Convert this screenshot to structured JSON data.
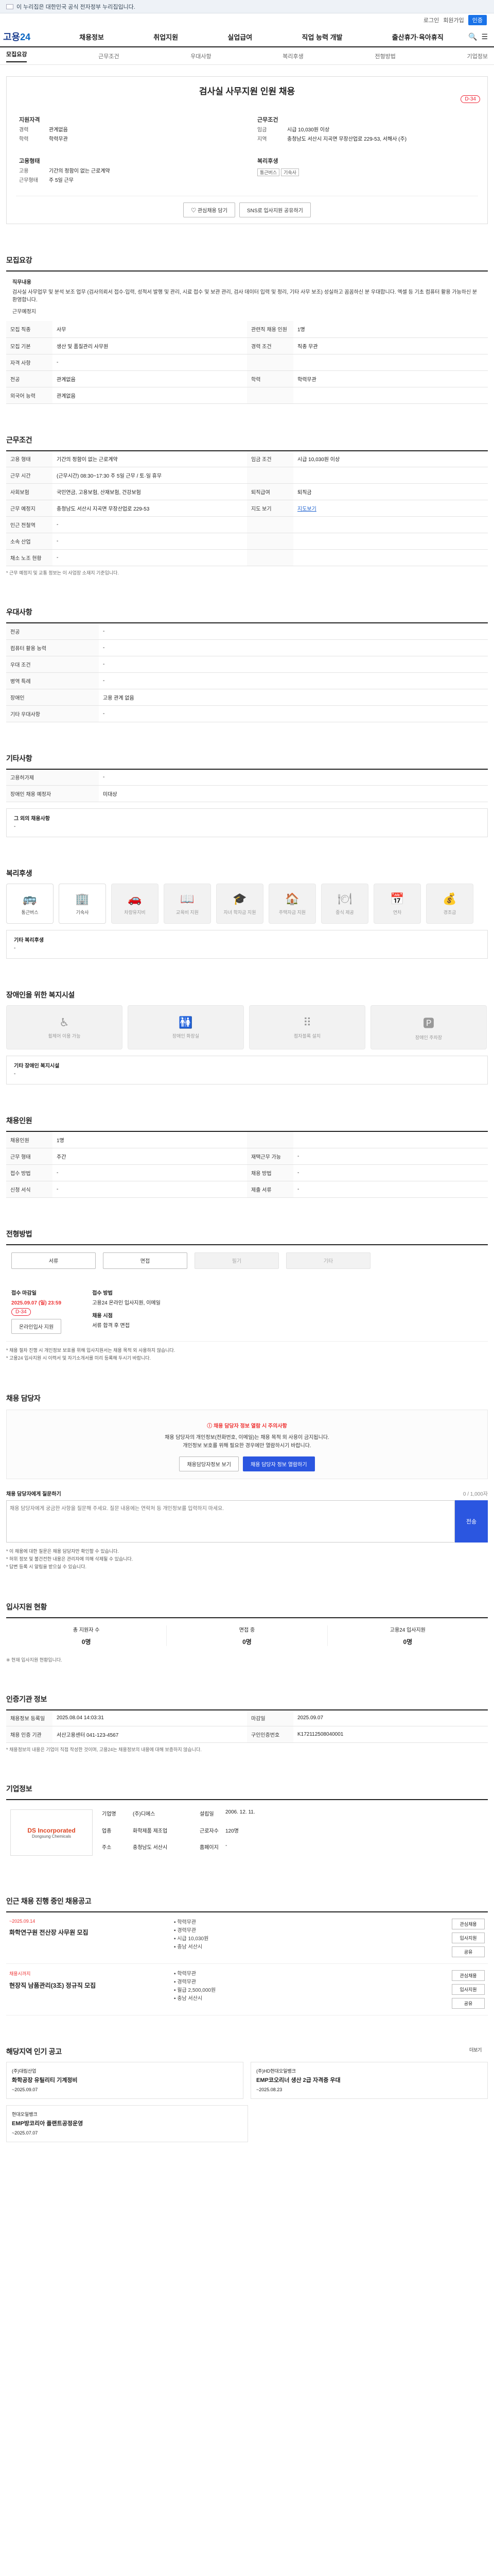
{
  "gov": {
    "text": "이 누리집은 대한민국 공식 전자정부 누리집입니다."
  },
  "util": {
    "login": "로그인",
    "join": "회원가입",
    "cert": "인증"
  },
  "logo": {
    "a": "고용",
    "b": "24"
  },
  "gnb": [
    "채용정보",
    "취업지원",
    "실업급여",
    "직업 능력 개발",
    "출산휴가·육아휴직"
  ],
  "tabs": [
    "모집요강",
    "근무조건",
    "우대사항",
    "복리후생",
    "전형방법",
    "기업정보"
  ],
  "posting": {
    "title": "검사실 사무지원 인원 채용",
    "dday": "D-34",
    "left_head": "지원자격",
    "right_head": "근무조건",
    "left": [
      {
        "k": "경력",
        "v": "관계없음"
      },
      {
        "k": "학력",
        "v": "학력무관"
      }
    ],
    "right": [
      {
        "k": "임금",
        "v": "시급 10,030원 이상"
      },
      {
        "k": "지역",
        "v": "충청남도 서산시 지곡면 무장산업로 229-53, 서해사 (주)"
      }
    ],
    "left2_head": "고용형태",
    "right2_head": "복리후생",
    "left2": [
      {
        "k": "고용",
        "v": "기간의 정함이 없는 근로계약"
      },
      {
        "k": "근무형태",
        "v": "주 5일 근무"
      }
    ],
    "benefits": [
      "통근버스",
      "기숙사"
    ],
    "btn_save": "관심채용 담기",
    "btn_share": "SNS로 입사지원 공유하기"
  },
  "s1": {
    "title": "모집요강",
    "lbl": "직무내용",
    "desc": "검사실 사무업무 및 분석 보조 업무 (검사의뢰서 접수·입력, 성적서 발행 및 관리, 시료 접수 및 보관 관리, 검사 데이터 입력 및 정리, 기타 사무 보조) 성실하고 꼼꼼하신 분 우대합니다. 엑셀 등 기초 컴퓨터 활용 가능하신 분 환영합니다.",
    "lbl2": "근무예정지",
    "rows": [
      [
        {
          "k": "모집 직종",
          "v": "사무"
        },
        {
          "k": "관련직 채용 인원",
          "v": "1명"
        }
      ],
      [
        {
          "k": "모집 기본",
          "v": "생산 및 품질관리 사무원"
        },
        {
          "k": "경력 조건",
          "v": "직종 무관"
        }
      ],
      [
        {
          "k": "자격 사항",
          "v": "-"
        },
        {
          "k": "",
          "v": ""
        }
      ],
      [
        {
          "k": "전공",
          "v": "관계없음"
        },
        {
          "k": "학력",
          "v": "학력무관"
        }
      ],
      [
        {
          "k": "외국어 능력",
          "v": "관계없음"
        },
        {
          "k": "",
          "v": ""
        }
      ]
    ]
  },
  "s2": {
    "title": "근무조건",
    "rows": [
      [
        {
          "k": "고용 형태",
          "v": "기간의 정함이 없는 근로계약"
        },
        {
          "k": "임금 조건",
          "v": "시급 10,030원 이상"
        }
      ],
      [
        {
          "k": "근무 시간",
          "v": "(근무시간) 08:30~17:30 주 5일 근무 / 토·일 휴무"
        },
        {
          "k": "",
          "v": ""
        }
      ],
      [
        {
          "k": "사회보험",
          "v": "국민연금, 고용보험, 산재보험, 건강보험"
        },
        {
          "k": "퇴직급여",
          "v": "퇴직금"
        }
      ],
      [
        {
          "k": "근무 예정지",
          "v": "충청남도 서산시 지곡면 무장산업로 229-53"
        },
        {
          "k": "지도 보기",
          "v": "지도보기"
        }
      ],
      [
        {
          "k": "인근 전철역",
          "v": "-"
        },
        {
          "k": "",
          "v": ""
        }
      ],
      [
        {
          "k": "소속 산업",
          "v": "-"
        },
        {
          "k": "",
          "v": ""
        }
      ],
      [
        {
          "k": "채소 노조 현황",
          "v": "-"
        },
        {
          "k": "",
          "v": ""
        }
      ]
    ],
    "note": "* 근무 예정지 및 교통 정보는 이 사업장 소재지 기준입니다."
  },
  "s3": {
    "title": "우대사항",
    "rows": [
      [
        {
          "k": "전공",
          "v": "-"
        }
      ],
      [
        {
          "k": "컴퓨터 활용 능력",
          "v": "-"
        }
      ],
      [
        {
          "k": "우대 조건",
          "v": "-"
        }
      ],
      [
        {
          "k": "병역 특례",
          "v": "-"
        }
      ],
      [
        {
          "k": "장애인",
          "v": "고용 관계 없음"
        }
      ],
      [
        {
          "k": "기타 우대사항",
          "v": "-"
        }
      ]
    ]
  },
  "s4": {
    "title": "기타사항",
    "rows": [
      [
        {
          "k": "고용허가제",
          "v": "-"
        }
      ],
      [
        {
          "k": "장애인 채용 예정자",
          "v": "미대상"
        }
      ]
    ],
    "box_t": "그 외의 채용사항",
    "box_v": "-"
  },
  "s5": {
    "title": "복리후생",
    "icons": [
      {
        "n": "통근버스",
        "on": true,
        "g": "🚌"
      },
      {
        "n": "기숙사",
        "on": true,
        "g": "🏢"
      },
      {
        "n": "차량유지비",
        "on": false,
        "g": "🚗"
      },
      {
        "n": "교육비 지원",
        "on": false,
        "g": "📖"
      },
      {
        "n": "자녀 학자금 지원",
        "on": false,
        "g": "🎓"
      },
      {
        "n": "주택자금 지원",
        "on": false,
        "g": "🏠"
      },
      {
        "n": "중식 제공",
        "on": false,
        "g": "🍽"
      },
      {
        "n": "연차",
        "on": false,
        "g": "📅"
      },
      {
        "n": "경조금",
        "on": false,
        "g": "💰"
      }
    ],
    "box_t": "기타 복리후생",
    "box_v": "-"
  },
  "s6": {
    "title": "장애인을 위한 복지시설",
    "icons": [
      {
        "n": "휠체어 이용 가능",
        "g": "♿"
      },
      {
        "n": "장애인 화장실",
        "g": "🚻"
      },
      {
        "n": "점자블록 설치",
        "g": "⠿"
      },
      {
        "n": "장애인 주차장",
        "g": "🅿"
      }
    ],
    "box_t": "기타 장애인 복지시설",
    "box_v": "-"
  },
  "s7": {
    "title": "채용인원",
    "rows": [
      [
        {
          "k": "채용인원",
          "v": "1명"
        },
        {
          "k": "",
          "v": ""
        }
      ],
      [
        {
          "k": "근무 형태",
          "v": "주간"
        },
        {
          "k": "재택근무 가능",
          "v": "-"
        }
      ],
      [
        {
          "k": "접수 방법",
          "v": "-"
        },
        {
          "k": "채용 방법",
          "v": "-"
        }
      ],
      [
        {
          "k": "신청 서식",
          "v": "-"
        },
        {
          "k": "제출 서류",
          "v": "-"
        }
      ]
    ]
  },
  "s8": {
    "title": "전형방법",
    "steps": [
      {
        "n": "서류",
        "on": true
      },
      {
        "n": "면접",
        "on": true
      },
      {
        "n": "필기",
        "on": false
      },
      {
        "n": "기타",
        "on": false
      }
    ],
    "p1": "접수 마감일",
    "p1v": "2025.09.07 (일) 23:59",
    "p1s": "D-34",
    "p2": "접수 방법",
    "p2v": "고용24 온라인 입사지원, 이메일",
    "p3": "채용 시점",
    "p3v": "서류 합격 후 면접",
    "btn": "온라인입사 지원",
    "notes": [
      "* 채용 절차 진행 시 개인정보 보호를 위해 입사지원서는 채용 목적 외 사용하지 않습니다.",
      "* 고용24 입사지원 시 이력서 및 자기소개서를 미리 등록해 두시기 바랍니다."
    ]
  },
  "s9": {
    "title": "채용 담당자",
    "warn1": "채용 담당자 정보 열람 시 주의사항",
    "warn2": "채용 담당자의 개인정보(전화번호, 이메일)는 채용 목적 외 사용이 금지됩니다.",
    "warn3": "개인정보 보호를 위해 필요한 경우에만 열람하시기 바랍니다.",
    "b1": "채용담당자정보 보기",
    "b2": "채용 담당자 정보 열람하기",
    "qa_t": "채용 담당자에게 질문하기",
    "qa_r": "0 / 1,000자",
    "qa_p": "채용 담당자에게 궁금한 사항을 질문해 주세요. 질문 내용에는 연락처 등 개인정보를 입력하지 마세요.",
    "qa_btn": "전송",
    "qn": [
      "* 이 채용에 대한 질문은 채용 담당자만 확인할 수 있습니다.",
      "* 허위 정보 및 불건전한 내용은 관리자에 의해 삭제될 수 있습니다.",
      "* 답변 등록 시 알림을 받으실 수 있습니다."
    ]
  },
  "s10": {
    "title": "입사지원 현황",
    "st": [
      {
        "n": "총 지원자 수",
        "v": "0명"
      },
      {
        "n": "면접 중",
        "v": "0명"
      },
      {
        "n": "고용24 입사지원",
        "v": "0명"
      }
    ],
    "note": "※ 현재 입사지원 현황입니다."
  },
  "s11": {
    "title": "인증기관 정보",
    "rows": [
      [
        {
          "k": "채용정보 등록일",
          "v": "2025.08.04 14:03:31"
        },
        {
          "k": "마감일",
          "v": "2025.09.07"
        }
      ],
      [
        {
          "k": "채용 인증 기관",
          "v": "서산고용센터 041-123-4567"
        },
        {
          "k": "구인인증번호",
          "v": "K172112508040001"
        }
      ]
    ],
    "note": "* 채용정보의 내용은 기업이 직접 작성한 것이며, 고용24는 채용정보의 내용에 대해 보증하지 않습니다."
  },
  "s12": {
    "title": "기업정보",
    "logo_n": "DS Incorporated",
    "logo_s": "Dongsung Chemicals",
    "rows": [
      {
        "k": "기업명",
        "v": "(주)디에스"
      },
      {
        "k": "설립일",
        "v": "2006. 12. 11."
      },
      {
        "k": "업종",
        "v": "화학제품 제조업"
      },
      {
        "k": "근로자수",
        "v": "120명"
      },
      {
        "k": "주소",
        "v": "충청남도 서산시"
      },
      {
        "k": "홈페이지",
        "v": "-"
      }
    ]
  },
  "s13": {
    "title": "인근 채용 진행 중인 채용공고",
    "items": [
      {
        "dt": "~2025.09.14",
        "nm": "화학연구원 전산장 사무원 모집",
        "m": [
          "학력무관",
          "경력무관",
          "시급 10,030원",
          "충남 서산시"
        ],
        "b": [
          "관심채용",
          "입사지원",
          "공유"
        ]
      },
      {
        "dt": "채용시까지",
        "nm": "현장직 남품관리(3조) 정규직 모집",
        "m": [
          "학력무관",
          "경력무관",
          "월급 2,500,000원",
          "충남 서산시"
        ],
        "b": [
          "관심채용",
          "입사지원",
          "공유"
        ]
      }
    ]
  },
  "s14": {
    "title": "해당지역 인기 공고",
    "more": "더보기",
    "cards": [
      {
        "t": "(주)대림산업",
        "nm": "화학공장 유틸리티 기계정비",
        "s": "~2025.09.07"
      },
      {
        "t": "(주)HD현대오일뱅크",
        "nm": "EMP코오리너 생산 2급 자격증 우대",
        "s": "~2025.08.23"
      }
    ],
    "card3": {
      "t": "현대오일뱅크",
      "nm": "EMP방코리아 플랜트공정운영",
      "s": "~2025.07.07"
    }
  }
}
